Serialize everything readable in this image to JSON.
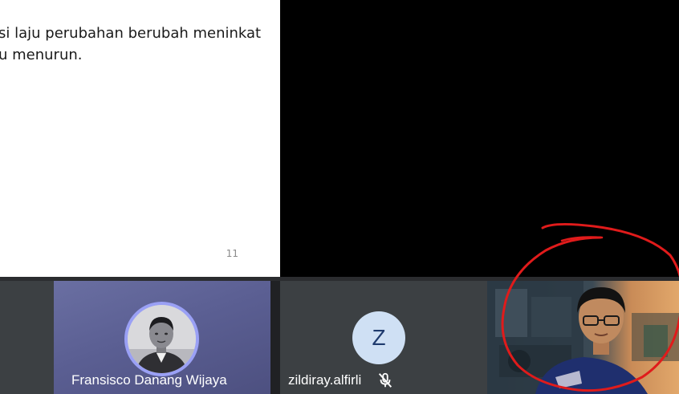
{
  "presentation": {
    "slide_text": "si laju perubahan berubah meninkat\nu menurun.",
    "page_number": "11"
  },
  "participants": [
    {
      "name": "Fransisco Danang Wijaya",
      "avatar": "profile-photo"
    },
    {
      "name": "zildiray.alfirli",
      "avatar_letter": "Z",
      "mic": "muted"
    },
    {
      "name": "",
      "video": "camera-feed"
    }
  ],
  "annotation": {
    "color": "#e01b1b",
    "shape": "freehand-circle"
  },
  "colors": {
    "strip_bg": "#202124",
    "tile_bg": "#3c4043",
    "active_ring": "#9aa0f5",
    "letter_avatar_bg": "#cfe0f4"
  }
}
